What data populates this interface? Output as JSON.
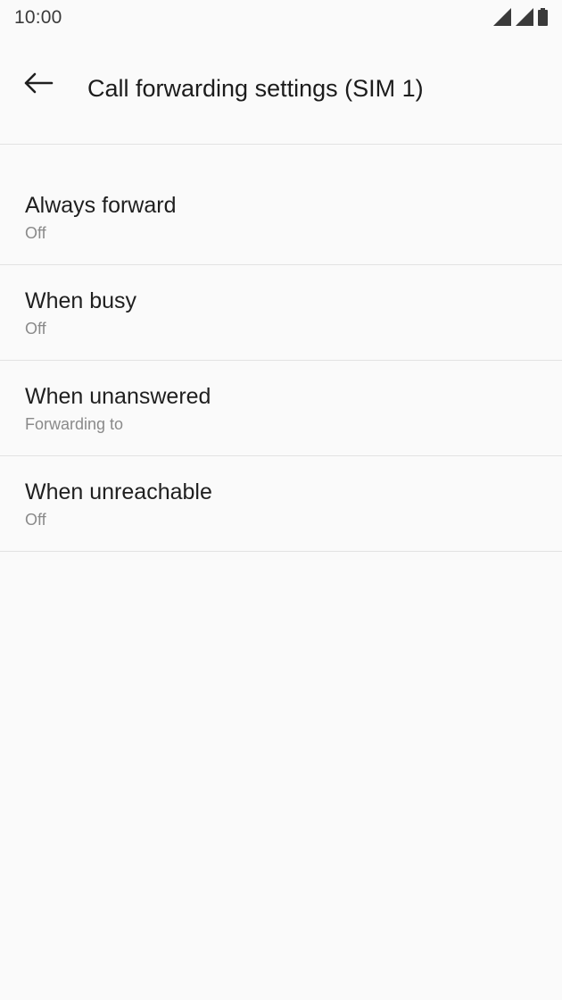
{
  "status_bar": {
    "time": "10:00",
    "icons": [
      "signal-sim1-icon",
      "signal-sim2-icon",
      "battery-icon"
    ]
  },
  "header": {
    "back_icon": "arrow-left-icon",
    "title": "Call forwarding settings (SIM 1)"
  },
  "settings": [
    {
      "title": "Always forward",
      "summary": "Off"
    },
    {
      "title": "When busy",
      "summary": "Off"
    },
    {
      "title": "When unanswered",
      "summary": "Forwarding to"
    },
    {
      "title": "When unreachable",
      "summary": "Off"
    }
  ]
}
